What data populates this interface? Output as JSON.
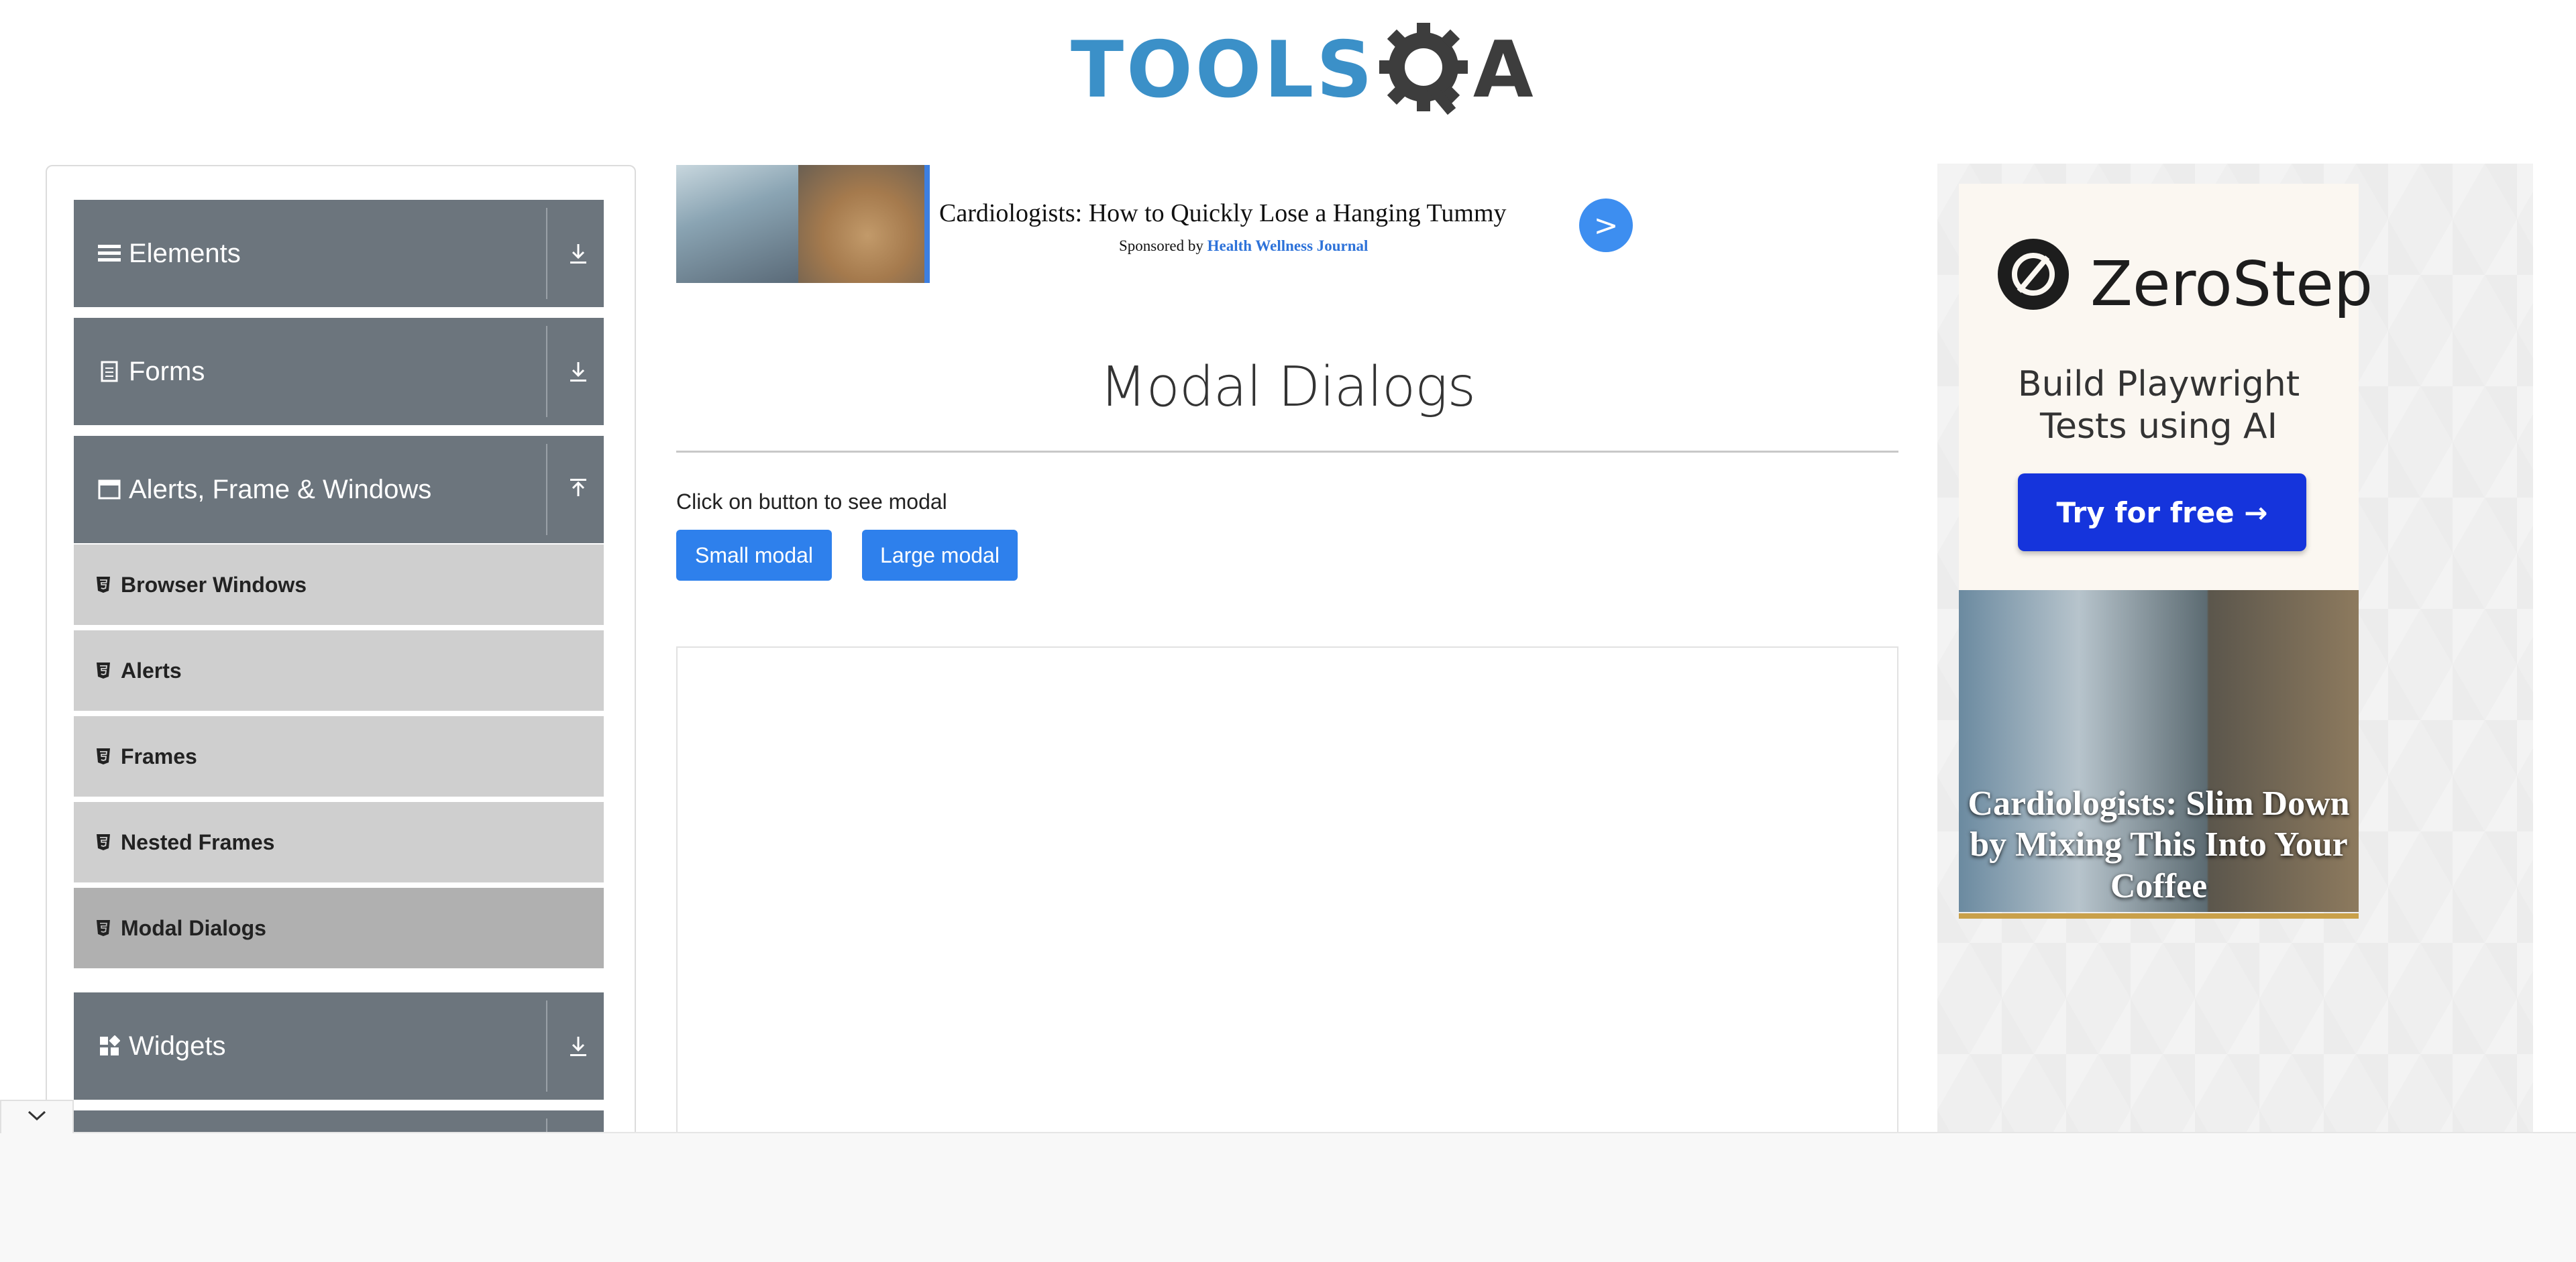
{
  "header": {
    "logo_text_left": "TOOLS",
    "logo_text_right": "A"
  },
  "sidebar": {
    "groups": [
      {
        "label": "Elements",
        "icon": "menu-icon",
        "arrow": "download-icon"
      },
      {
        "label": "Forms",
        "icon": "document-icon",
        "arrow": "download-icon"
      },
      {
        "label": "Alerts, Frame & Windows",
        "icon": "window-icon",
        "arrow": "upload-icon"
      },
      {
        "label": "Widgets",
        "icon": "widgets-icon",
        "arrow": "download-icon"
      }
    ],
    "items": [
      {
        "label": "Browser Windows"
      },
      {
        "label": "Alerts"
      },
      {
        "label": "Frames"
      },
      {
        "label": "Nested Frames"
      },
      {
        "label": "Modal Dialogs",
        "active": true
      }
    ]
  },
  "ad_top": {
    "title": "Cardiologists: How to Quickly Lose a Hanging Tummy",
    "sponsor_prefix": "Sponsored by",
    "sponsor_name": "Health Wellness Journal",
    "go_label": ">"
  },
  "main": {
    "title": "Modal Dialogs",
    "hint": "Click on button to see modal",
    "small_button": "Small modal",
    "large_button": "Large modal"
  },
  "ad_right": {
    "brand": "ZeroStep",
    "tagline_line1": "Build Playwright",
    "tagline_line2": "Tests using AI",
    "cta": "Try for free →",
    "photo_caption": "Cardiologists: Slim Down by Mixing This Into Your Coffee"
  },
  "colors": {
    "sidebar_header": "#6c757d",
    "sidebar_item": "#cfcfcf",
    "sidebar_active": "#b0b0b0",
    "primary_button": "#2e80ec",
    "zerostep_cta": "#1534dc",
    "logo_blue": "#3b90c8"
  }
}
